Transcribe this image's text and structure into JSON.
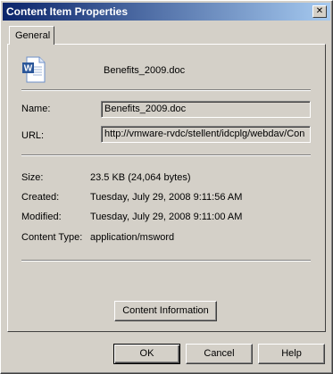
{
  "window": {
    "title": "Content Item Properties",
    "close_glyph": "✕"
  },
  "tabs": [
    {
      "label": "General"
    }
  ],
  "file": {
    "name": "Benefits_2009.doc",
    "icon": "word-document-icon"
  },
  "fields": {
    "name": {
      "label": "Name:",
      "value": "Benefits_2009.doc"
    },
    "url": {
      "label": "URL:",
      "value": "http://vmware-rvdc/stellent/idcplg/webdav/Con"
    }
  },
  "info": {
    "size": {
      "label": "Size:",
      "value": "23.5 KB (24,064 bytes)"
    },
    "created": {
      "label": "Created:",
      "value": "Tuesday, July 29, 2008 9:11:56 AM"
    },
    "modified": {
      "label": "Modified:",
      "value": "Tuesday, July 29, 2008 9:11:00 AM"
    },
    "content_type": {
      "label": "Content Type:",
      "value": "application/msword"
    }
  },
  "buttons": {
    "content_information": "Content Information",
    "ok": "OK",
    "cancel": "Cancel",
    "help": "Help"
  },
  "colors": {
    "titlebar_start": "#0a246a",
    "titlebar_end": "#a6caf0",
    "dialog_bg": "#d4d0c8",
    "word_blue": "#2b579a"
  }
}
